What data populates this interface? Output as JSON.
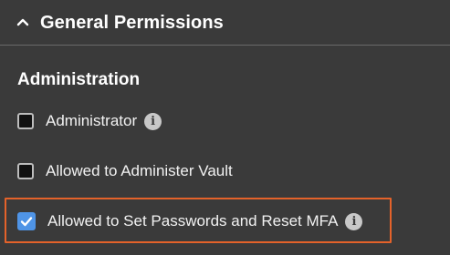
{
  "section": {
    "title": "General Permissions",
    "expanded": true,
    "chevron_icon": "chevron-up-icon"
  },
  "group": {
    "title": "Administration"
  },
  "permissions": [
    {
      "label": "Administrator",
      "checked": false,
      "has_info": true,
      "info_icon": "info-icon"
    },
    {
      "label": "Allowed to Administer Vault",
      "checked": false,
      "has_info": false
    },
    {
      "label": "Allowed to Set Passwords and Reset MFA",
      "checked": true,
      "has_info": true,
      "info_icon": "info-icon"
    }
  ],
  "info_glyph": "i",
  "colors": {
    "background": "#3a3a3a",
    "checkbox_checked": "#4f94e6",
    "highlight": "#e4622a",
    "info_icon": "#c8c8c8"
  }
}
